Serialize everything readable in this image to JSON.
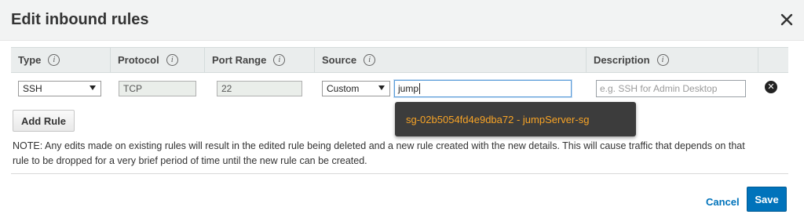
{
  "dialog": {
    "title": "Edit inbound rules"
  },
  "columns": {
    "type": "Type",
    "protocol": "Protocol",
    "port_range": "Port Range",
    "source": "Source",
    "description": "Description",
    "info_glyph": "i"
  },
  "rule": {
    "type": "SSH",
    "protocol": "TCP",
    "port_range": "22",
    "source_mode": "Custom",
    "source_value": "jump",
    "description_placeholder": "e.g. SSH for Admin Desktop"
  },
  "suggestion": {
    "text": "sg-02b5054fd4e9dba72 - jumpServer-sg"
  },
  "buttons": {
    "add_rule": "Add Rule",
    "cancel": "Cancel",
    "save": "Save"
  },
  "note": {
    "text": "NOTE: Any edits made on existing rules will result in the edited rule being deleted and a new rule created with the new details. This will cause traffic that depends on that rule to be dropped for a very brief period of time until the new rule can be created."
  },
  "colors": {
    "primary": "#0073bb",
    "suggestion_text": "#f7a326",
    "suggestion_bg": "#3c3c3c"
  }
}
